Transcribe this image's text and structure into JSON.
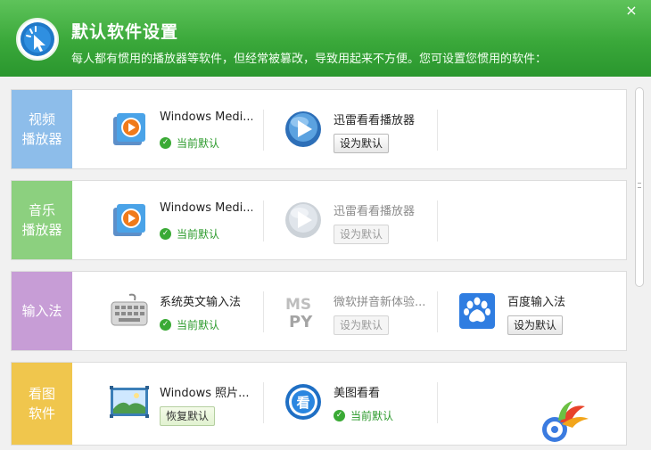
{
  "window": {
    "title": "默认软件设置",
    "subtitle": "每人都有惯用的播放器等软件，但经常被篡改，导致用起来不方便。您可设置您惯用的软件：",
    "close_symbol": "×"
  },
  "colors": {
    "header_green": "#3aa83a",
    "video_label": "#8dbdea",
    "music_label": "#8cd07f",
    "ime_label": "#c79dd6",
    "image_label": "#f0c64d",
    "status_green": "#2b9a2b"
  },
  "categories": [
    {
      "label_line1": "视频",
      "label_line2": "播放器",
      "apps": [
        {
          "name": "Windows Medi...",
          "icon": "windows-media-player-icon",
          "status": "当前默认"
        },
        {
          "name": "迅雷看看播放器",
          "icon": "xunlei-kankan-icon",
          "button": "设为默认"
        }
      ]
    },
    {
      "label_line1": "音乐",
      "label_line2": "播放器",
      "apps": [
        {
          "name": "Windows Medi...",
          "icon": "windows-media-player-icon",
          "status": "当前默认"
        },
        {
          "name": "迅雷看看播放器",
          "icon": "xunlei-kankan-icon",
          "button": "设为默认"
        }
      ]
    },
    {
      "label_line1": "输入法",
      "label_line2": "",
      "apps": [
        {
          "name": "系统英文输入法",
          "icon": "keyboard-icon",
          "status": "当前默认"
        },
        {
          "name": "微软拼音新体验...",
          "icon": "ms-pinyin-icon",
          "button": "设为默认"
        },
        {
          "name": "百度输入法",
          "icon": "baidu-input-icon",
          "button": "设为默认"
        }
      ]
    },
    {
      "label_line1": "看图",
      "label_line2": "软件",
      "apps": [
        {
          "name": "Windows 照片...",
          "icon": "windows-photo-viewer-icon",
          "button": "恢复默认"
        },
        {
          "name": "美图看看",
          "icon": "meitu-kankan-icon",
          "status": "当前默认"
        }
      ]
    }
  ]
}
